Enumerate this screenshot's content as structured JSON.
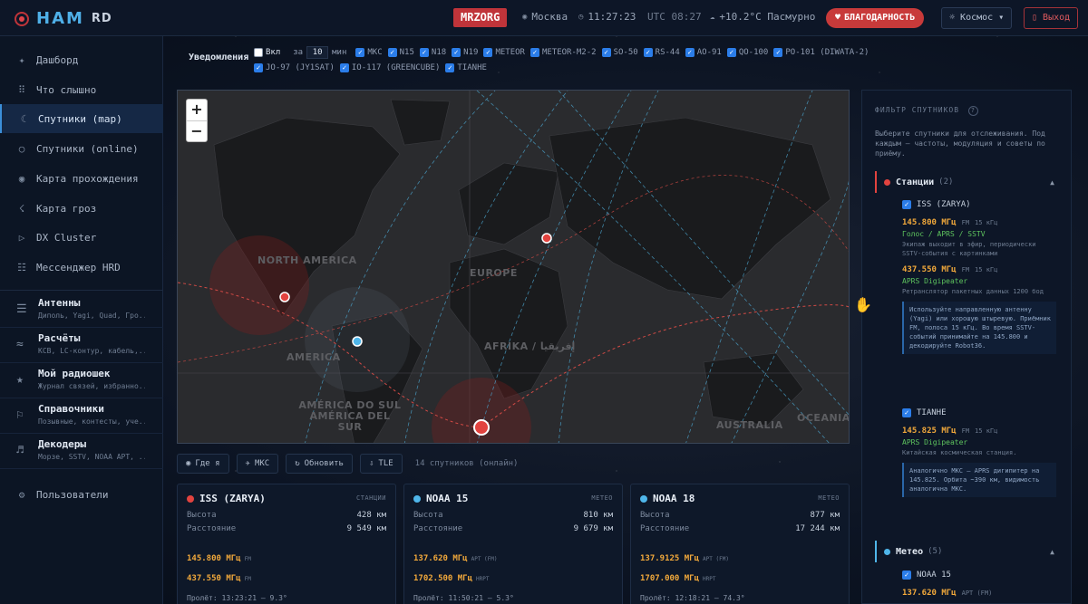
{
  "header": {
    "logo_main": "HAM",
    "logo_sub": "RD",
    "callsign": "MRZORG",
    "city": "Москва",
    "local_time": "11:27:23",
    "utc_label": "UTC 08:27",
    "weather": "+10.2°C Пасмурно",
    "thanks_button": "БЛАГОДАРНОСТЬ",
    "theme_select": "Космос ▾",
    "logout_button": "Выход"
  },
  "sidebar": {
    "items": [
      {
        "icon": "✦",
        "label": "Дашборд"
      },
      {
        "icon": "⠿",
        "label": "Что слышно"
      },
      {
        "icon": "☾",
        "label": "Спутники (map)"
      },
      {
        "icon": "○",
        "label": "Спутники (online)"
      },
      {
        "icon": "◉",
        "label": "Карта прохождения"
      },
      {
        "icon": "☇",
        "label": "Карта гроз"
      },
      {
        "icon": "▷",
        "label": "DX Cluster"
      },
      {
        "icon": "☷",
        "label": "Мессенджер HRD"
      }
    ],
    "groups": [
      {
        "icon": "☰",
        "title": "Антенны",
        "sub": "Диполь, Yagi, Quad, Гро..."
      },
      {
        "icon": "≈",
        "title": "Расчёты",
        "sub": "КСВ, LC-контур, кабель,..."
      },
      {
        "icon": "★",
        "title": "Мой радиошек",
        "sub": "Журнал связей, избранно..."
      },
      {
        "icon": "⚐",
        "title": "Справочники",
        "sub": "Позывные, контесты, уче..."
      },
      {
        "icon": "♬",
        "title": "Декодеры",
        "sub": "Морзе, SSTV, NOAA APT, ..."
      }
    ],
    "users": {
      "icon": "⚙",
      "label": "Пользователи"
    }
  },
  "notifications": {
    "label": "Уведомления",
    "enable_label": "Вкл",
    "for_label": "за",
    "minutes_value": "10",
    "minutes_unit": "мин",
    "satellites": [
      "МКС",
      "N15",
      "N18",
      "N19",
      "METEOR",
      "METEOR-M2-2",
      "SO-50",
      "RS-44",
      "AO-91",
      "QO-100",
      "PO-101 (DIWATA-2)",
      "JO-97 (JY1SAT)",
      "IO-117 (GREENCUBE)",
      "TIANHE"
    ]
  },
  "map": {
    "zoom_in": "+",
    "zoom_out": "−",
    "labels": {
      "north_america": "NORTH AMERICA",
      "europe": "EUROPE",
      "america": "AMERICA",
      "africa": "AFRIKA / إفريقيا",
      "south_america": "AMÉRICA DO SUL AMÉRICA DEL SUR",
      "australia": "AUSTRALIA",
      "oceania": "OCEANIA"
    }
  },
  "map_toolbar": {
    "where_me": "Где я",
    "iss": "МКС",
    "refresh": "Обновить",
    "tle": "TLE",
    "online_count": "14 спутников (онлайн)"
  },
  "cards": [
    {
      "name": "ISS (ZARYA)",
      "category": "СТАНЦИИ",
      "color": "#e2433f",
      "altitude_label": "Высота",
      "altitude": "428 км",
      "distance_label": "Расстояние",
      "distance": "9 549 км",
      "freq1": "145.800 МГц",
      "mode1": "FM",
      "freq2": "437.550 МГц",
      "mode2": "FM",
      "pass": "Пролёт: 13:23:21 — 9.3°"
    },
    {
      "name": "NOAA 15",
      "category": "МЕТЕО",
      "color": "#4fb6ea",
      "altitude_label": "Высота",
      "altitude": "810 км",
      "distance_label": "Расстояние",
      "distance": "9 679 км",
      "freq1": "137.620 МГц",
      "mode1": "APT (FM)",
      "freq2": "1702.500 МГц",
      "mode2": "HRPT",
      "pass": "Пролёт: 11:50:21 — 5.3°"
    },
    {
      "name": "NOAA 18",
      "category": "МЕТЕО",
      "color": "#4fb6ea",
      "altitude_label": "Высота",
      "altitude": "877 км",
      "distance_label": "Расстояние",
      "distance": "17 244 км",
      "freq1": "137.9125 МГц",
      "mode1": "APT (FM)",
      "freq2": "1707.000 МГц",
      "mode2": "HRPT",
      "pass": "Пролёт: 12:18:21 — 74.3°"
    }
  ],
  "filter": {
    "title": "ФИЛЬТР СПУТНИКОВ",
    "help": "?",
    "description": "Выберите спутники для отслеживания. Под каждым — частоты, модуляция и советы по приёму.",
    "stations": {
      "label": "Станции",
      "count": "(2)",
      "caret": "▲",
      "iss": {
        "name": "ISS (ZARYA)",
        "f1": "145.800 МГц",
        "m1": "FM",
        "bw1": "15 кГц",
        "mode1": "Голос / APRS / SSTV",
        "note1": "Экипаж выходит в эфир, периодически SSTV-события с картинками",
        "f2": "437.550 МГц",
        "m2": "FM",
        "bw2": "15 кГц",
        "mode2": "APRS Digipeater",
        "note2": "Ретранслятор пакетных данных 1200 бод",
        "tip": "Используйте направленную антенну (Yagi) или хорошую штыревую. Приёмник FM, полоса 15 кГц. Во время SSTV-событий принимайте на 145.800 и декодируйте Robot36."
      },
      "tianhe": {
        "name": "TIANHE",
        "f1": "145.825 МГц",
        "m1": "FM",
        "bw1": "15 кГц",
        "mode1": "APRS Digipeater",
        "note1": "Китайская космическая станция.",
        "tip": "Аналогично МКС — APRS дигипитер на 145.825. Орбита ~390 км, видимость аналогична МКС."
      }
    },
    "meteo": {
      "label": "Метео",
      "count": "(5)",
      "caret": "▲",
      "noaa15": {
        "name": "NOAA 15",
        "f1": "137.620 МГц",
        "m1": "APT (FM)"
      }
    }
  },
  "colors": {
    "accent": "#3b8fd9",
    "danger": "#c0343a",
    "freq": "#f2a93b",
    "mode": "#5ec45e"
  }
}
